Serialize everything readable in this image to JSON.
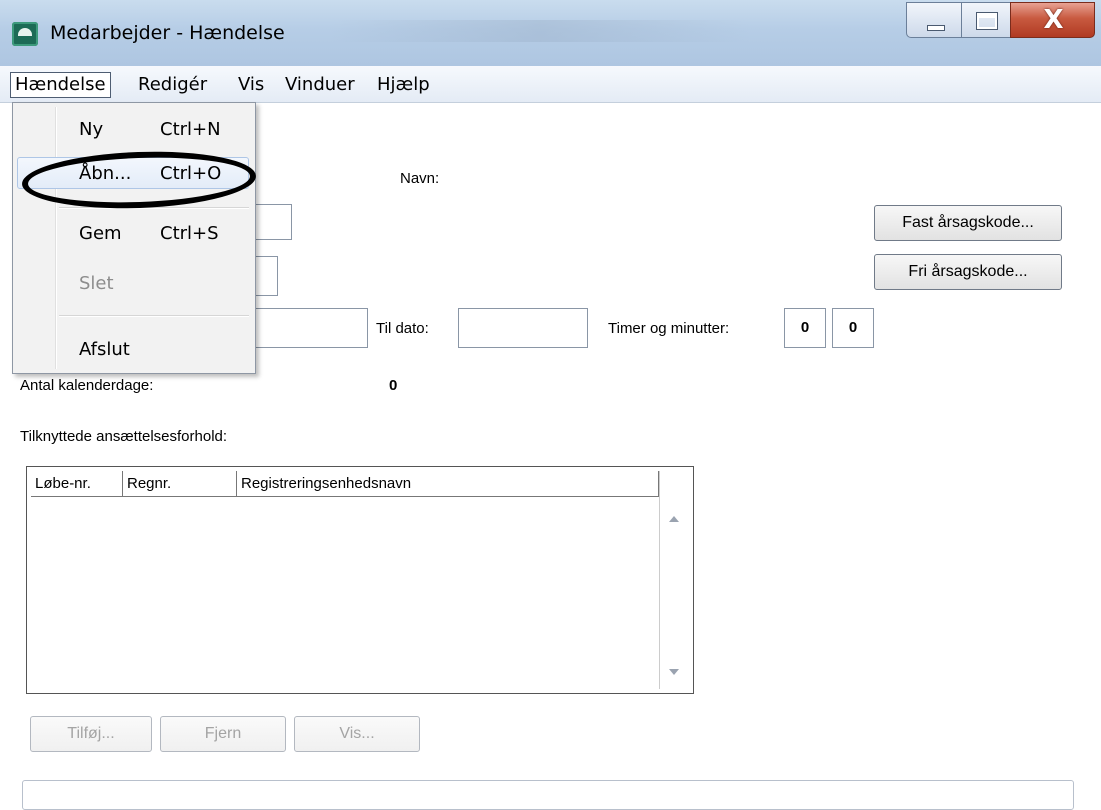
{
  "window": {
    "title": "Medarbejder - Hændelse",
    "close_glyph": "X"
  },
  "menubar": {
    "items": [
      {
        "label": "Hændelse"
      },
      {
        "label": "Redigér"
      },
      {
        "label": "Vis"
      },
      {
        "label": "Vinduer"
      },
      {
        "label": "Hjælp"
      }
    ]
  },
  "dropdown": {
    "items": [
      {
        "label": "Ny",
        "shortcut": "Ctrl+N"
      },
      {
        "label": "Åbn...",
        "shortcut": "Ctrl+O"
      },
      {
        "label": "Gem",
        "shortcut": "Ctrl+S"
      },
      {
        "label": "Slet",
        "shortcut": ""
      },
      {
        "label": "Afslut",
        "shortcut": ""
      }
    ]
  },
  "form": {
    "colon_fragment": ":",
    "navn_label": "Navn:",
    "navn_value": "",
    "til_dato_label": "Til dato:",
    "til_dato_value": "",
    "timer_label": "Timer og minutter:",
    "timer_hours": "0",
    "timer_minutes": "0",
    "antal_label": "Antal kalenderdage:",
    "antal_value": "0",
    "tilknyttede_label": "Tilknyttede ansættelsesforhold:"
  },
  "buttons": {
    "fast": "Fast årsagskode...",
    "fri": "Fri årsagskode...",
    "tilfoj": "Tilføj...",
    "fjern": "Fjern",
    "vis": "Vis..."
  },
  "table": {
    "columns": [
      "Løbe-nr.",
      "Regnr.",
      "Registreringsenhedsnavn"
    ],
    "rows": []
  },
  "colors": {
    "titlebar": "#b6cde6",
    "close_button": "#c85a40",
    "app_icon": "#1d6b56"
  }
}
